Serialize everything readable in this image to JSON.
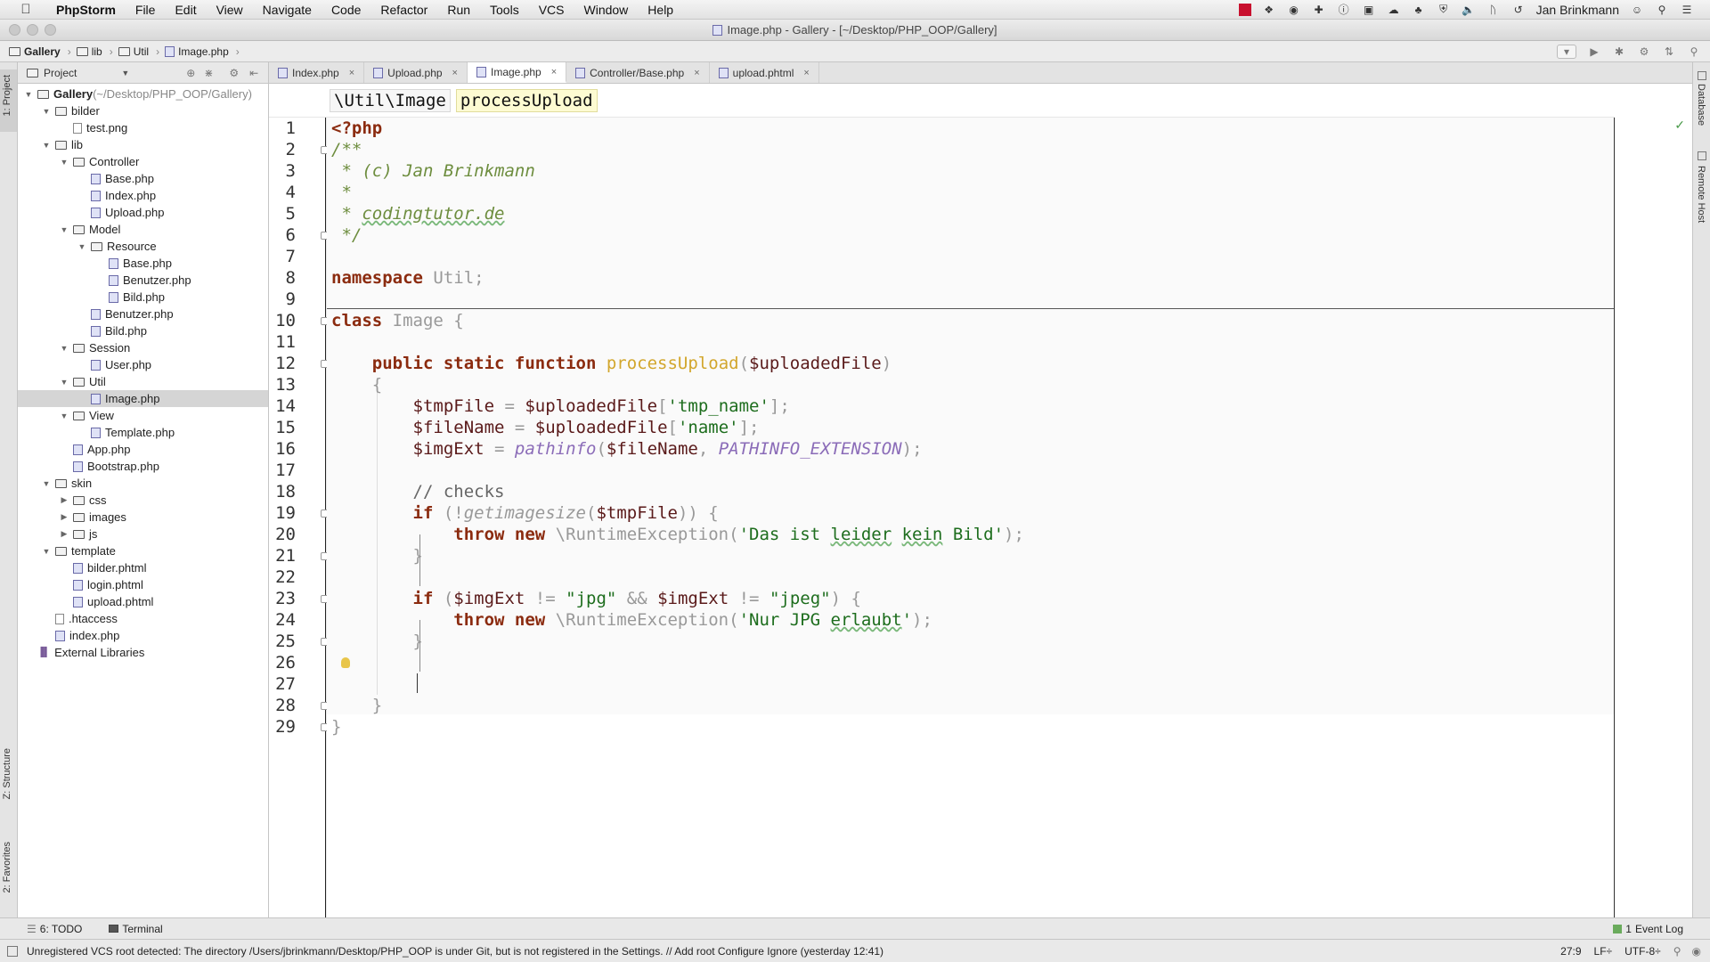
{
  "menubar": {
    "app": "PhpStorm",
    "items": [
      "File",
      "Edit",
      "View",
      "Navigate",
      "Code",
      "Refactor",
      "Run",
      "Tools",
      "VCS",
      "Window",
      "Help"
    ],
    "user": "Jan Brinkmann"
  },
  "window": {
    "title": "Image.php - Gallery - [~/Desktop/PHP_OOP/Gallery]"
  },
  "breadcrumb": {
    "items": [
      "Gallery",
      "lib",
      "Util",
      "Image.php"
    ]
  },
  "sidebar": {
    "stripe_project": "1: Project",
    "stripe_structure": "Z: Structure",
    "stripe_favorites": "2: Favorites",
    "panel_title": "Project",
    "tree": [
      {
        "label": "Gallery",
        "note": "(~/Desktop/PHP_OOP/Gallery)",
        "type": "folder",
        "depth": 0,
        "open": true
      },
      {
        "label": "bilder",
        "type": "folder",
        "depth": 1,
        "open": true
      },
      {
        "label": "test.png",
        "type": "file",
        "depth": 2
      },
      {
        "label": "lib",
        "type": "folder",
        "depth": 1,
        "open": true
      },
      {
        "label": "Controller",
        "type": "folder",
        "depth": 2,
        "open": true
      },
      {
        "label": "Base.php",
        "type": "php",
        "depth": 3
      },
      {
        "label": "Index.php",
        "type": "php",
        "depth": 3
      },
      {
        "label": "Upload.php",
        "type": "php",
        "depth": 3
      },
      {
        "label": "Model",
        "type": "folder",
        "depth": 2,
        "open": true
      },
      {
        "label": "Resource",
        "type": "folder",
        "depth": 3,
        "open": true
      },
      {
        "label": "Base.php",
        "type": "php",
        "depth": 4
      },
      {
        "label": "Benutzer.php",
        "type": "php",
        "depth": 4
      },
      {
        "label": "Bild.php",
        "type": "php",
        "depth": 4
      },
      {
        "label": "Benutzer.php",
        "type": "php",
        "depth": 3
      },
      {
        "label": "Bild.php",
        "type": "php",
        "depth": 3
      },
      {
        "label": "Session",
        "type": "folder",
        "depth": 2,
        "open": true
      },
      {
        "label": "User.php",
        "type": "php",
        "depth": 3
      },
      {
        "label": "Util",
        "type": "folder",
        "depth": 2,
        "open": true
      },
      {
        "label": "Image.php",
        "type": "php",
        "depth": 3,
        "selected": true
      },
      {
        "label": "View",
        "type": "folder",
        "depth": 2,
        "open": true
      },
      {
        "label": "Template.php",
        "type": "php",
        "depth": 3
      },
      {
        "label": "App.php",
        "type": "php",
        "depth": 2
      },
      {
        "label": "Bootstrap.php",
        "type": "php",
        "depth": 2
      },
      {
        "label": "skin",
        "type": "folder",
        "depth": 1,
        "open": true
      },
      {
        "label": "css",
        "type": "folder",
        "depth": 2,
        "open": false
      },
      {
        "label": "images",
        "type": "folder",
        "depth": 2,
        "open": false
      },
      {
        "label": "js",
        "type": "folder",
        "depth": 2,
        "open": false
      },
      {
        "label": "template",
        "type": "folder",
        "depth": 1,
        "open": true
      },
      {
        "label": "bilder.phtml",
        "type": "php",
        "depth": 2
      },
      {
        "label": "login.phtml",
        "type": "php",
        "depth": 2
      },
      {
        "label": "upload.phtml",
        "type": "php",
        "depth": 2
      },
      {
        "label": ".htaccess",
        "type": "file",
        "depth": 1
      },
      {
        "label": "index.php",
        "type": "php",
        "depth": 1
      },
      {
        "label": "External Libraries",
        "type": "lib",
        "depth": 0
      }
    ]
  },
  "editor": {
    "tabs": [
      {
        "label": "Index.php",
        "active": false
      },
      {
        "label": "Upload.php",
        "active": false
      },
      {
        "label": "Image.php",
        "active": true
      },
      {
        "label": "Controller/Base.php",
        "active": false
      },
      {
        "label": "upload.phtml",
        "active": false
      }
    ],
    "breadcrumb": [
      "\\Util\\Image",
      "processUpload"
    ],
    "line_numbers": [
      "1",
      "2",
      "3",
      "4",
      "5",
      "6",
      "7",
      "8",
      "9",
      "10",
      "11",
      "12",
      "13",
      "14",
      "15",
      "16",
      "17",
      "18",
      "19",
      "20",
      "21",
      "22",
      "23",
      "24",
      "25",
      "26",
      "27",
      "28",
      "29"
    ],
    "code": {
      "l1": "<?php",
      "l2": "/**",
      "l3a": " * ",
      "l3b": "(c) Jan Brinkmann",
      "l4": " *",
      "l5a": " * ",
      "l5b": "codingtutor.de",
      "l6": " */",
      "l8a": "namespace",
      "l8b": " Util",
      "l8c": ";",
      "l10a": "class",
      "l10b": " Image {",
      "l12a": "    public static function ",
      "l12b": "processUpload",
      "l12c": "(",
      "l12d": "$uploadedFile",
      "l12e": ")",
      "l13": "    {",
      "l14a": "        $tmpFile",
      "l14b": " = ",
      "l14c": "$uploadedFile",
      "l14d": "[",
      "l14e": "'tmp_name'",
      "l14f": "];",
      "l15a": "        $fileName",
      "l15b": " = ",
      "l15c": "$uploadedFile",
      "l15d": "[",
      "l15e": "'name'",
      "l15f": "];",
      "l16a": "        $imgExt",
      "l16b": " = ",
      "l16c": "pathinfo",
      "l16d": "(",
      "l16e": "$fileName",
      "l16f": ", ",
      "l16g": "PATHINFO_EXTENSION",
      "l16h": ");",
      "l18": "        // checks",
      "l19a": "        if",
      "l19b": " (!",
      "l19c": "getimagesize",
      "l19d": "(",
      "l19e": "$tmpFile",
      "l19f": ")) {",
      "l20a": "            throw new",
      "l20b": " \\RuntimeException(",
      "l20c": "'Das ist ",
      "l20d": "leider",
      "l20e": " ",
      "l20f": "kein",
      "l20g": " Bild'",
      "l20h": ");",
      "l21": "        }",
      "l23a": "        if",
      "l23b": " (",
      "l23c": "$imgExt",
      "l23d": " != ",
      "l23e": "\"jpg\"",
      "l23f": " && ",
      "l23g": "$imgExt",
      "l23h": " != ",
      "l23i": "\"jpeg\"",
      "l23j": ") {",
      "l24a": "            throw new",
      "l24b": " \\RuntimeException(",
      "l24c": "'Nur JPG ",
      "l24d": "erlaubt",
      "l24e": "'",
      "l24f": ");",
      "l25": "        }",
      "l28": "    }",
      "l29": "}"
    }
  },
  "rightstripe": {
    "database": "Database",
    "remote": "Remote Host"
  },
  "toolwindows": {
    "todo": "6: TODO",
    "terminal": "Terminal",
    "eventlog": "Event Log",
    "eventcount": "1"
  },
  "status": {
    "message": "Unregistered VCS root detected: The directory /Users/jbrinkmann/Desktop/PHP_OOP is under Git, but is not registered in the Settings. // Add root  Configure  Ignore (yesterday 12:41)",
    "position": "27:9",
    "line_sep": "LF÷",
    "encoding": "UTF-8÷"
  }
}
